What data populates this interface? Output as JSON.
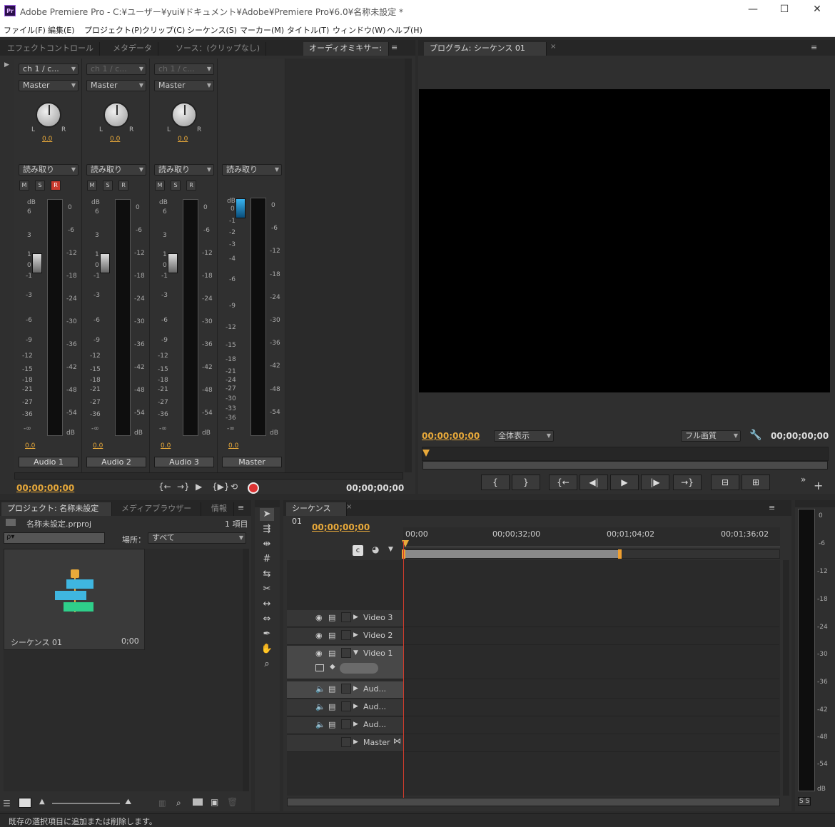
{
  "window": {
    "title": "Adobe Premiere Pro - C:¥ユーザー¥yui¥ドキュメント¥Adobe¥Premiere Pro¥6.0¥名称未設定 *",
    "logo": "Pr",
    "minimize": "—",
    "maximize": "☐",
    "close": "✕"
  },
  "menu": [
    "ファイル(F)",
    "編集(E)",
    "プロジェクト(P)",
    "クリップ(C)",
    "シーケンス(S)",
    "マーカー(M)",
    "タイトル(T)",
    "ウィンドウ(W)",
    "ヘルプ(H)"
  ],
  "source_panel": {
    "tabs": [
      "エフェクトコントロール",
      "メタデータ",
      "ソース：(クリップなし)",
      "オーディオミキサー: ："
    ],
    "channels": [
      {
        "route": "ch 1 / c...",
        "output": "Master",
        "pan": "0.0",
        "mode": "読み取り",
        "m": "M",
        "s": "S",
        "r": "R",
        "level": "0.0",
        "name": "Audio 1"
      },
      {
        "route": "ch 1 / c...",
        "output": "Master",
        "pan": "0.0",
        "mode": "読み取り",
        "m": "M",
        "s": "S",
        "r": "R",
        "level": "0.0",
        "name": "Audio 2"
      },
      {
        "route": "ch 1 / c...",
        "output": "Master",
        "pan": "0.0",
        "mode": "読み取り",
        "m": "M",
        "s": "S",
        "r": "R",
        "level": "0.0",
        "name": "Audio 3"
      }
    ],
    "master": {
      "mode": "読み取り",
      "level": "0.0",
      "name": "Master"
    },
    "fader_scale": [
      "6",
      "3",
      "1",
      "0",
      "-1",
      "-3",
      "-6",
      "-9",
      "-12",
      "-15",
      "-18",
      "-21",
      "-27",
      "-36",
      "-∞"
    ],
    "master_fader_scale": [
      "0",
      "-1",
      "-2",
      "-3",
      "-4",
      "-6",
      "-9",
      "-12",
      "-15",
      "-18",
      "-21",
      "-24",
      "-27",
      "-30",
      "-33",
      "-36",
      "-∞"
    ],
    "meter_scale": [
      "0",
      "-6",
      "-12",
      "-18",
      "-24",
      "-30",
      "-36",
      "-42",
      "-48",
      "-54",
      "dB"
    ],
    "db": "dB",
    "pan_left": "L",
    "pan_right": "R",
    "timecode_left": "00;00;00;00",
    "timecode_right": "00;00;00;00"
  },
  "program_panel": {
    "tab": "プログラム: シーケンス 01",
    "timecode_left": "00;00;00;00",
    "zoom": "全体表示",
    "quality": "フル画質",
    "timecode_right": "00;00;00;00",
    "controls": [
      "{",
      "}",
      "{←",
      "◀|",
      "▶",
      "|▶",
      "→}",
      "⊟",
      "⊞"
    ]
  },
  "project_panel": {
    "tabs": [
      "プロジェクト: 名称未設定",
      "メディアブラウザー",
      "情報"
    ],
    "file": "名称未設定.prproj",
    "count": "1 項目",
    "search_placeholder": "ρ▾",
    "location_label": "場所：",
    "location_value": "すべて",
    "item_name": "シーケンス 01",
    "item_duration": "0;00"
  },
  "timeline_panel": {
    "tab": "シーケンス 01",
    "timecode": "00;00;00;00",
    "ruler": [
      "00;00",
      "00;00;32;00",
      "00;01;04;02",
      "00;01;36;02"
    ],
    "video_tracks": [
      "Video 3",
      "Video 2",
      "Video 1"
    ],
    "audio_tracks": [
      "Aud...",
      "Aud...",
      "Aud...",
      "Master"
    ]
  },
  "master_meter": {
    "scale": [
      "0",
      "-6",
      "-12",
      "-18",
      "-24",
      "-30",
      "-36",
      "-42",
      "-48",
      "-54",
      "dB"
    ],
    "solo": "S S"
  },
  "status_bar": "既存の選択項目に追加または削除します。",
  "colors": {
    "accent_timecode": "#e8a93a",
    "playhead": "#d33c2c",
    "rec": "#c93a2e",
    "seq_blue": "#3fb6e0",
    "seq_green": "#2fcf8a"
  }
}
